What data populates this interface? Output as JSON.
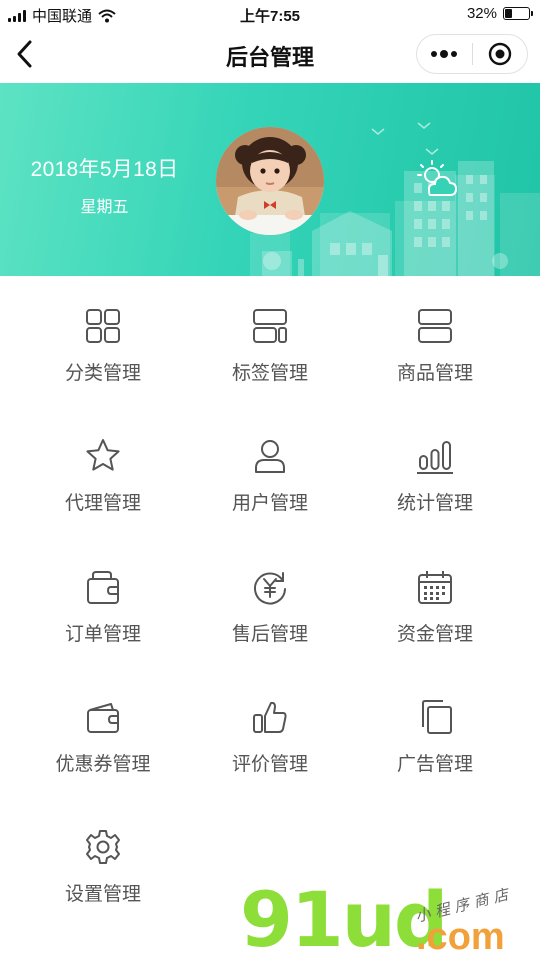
{
  "status_bar": {
    "carrier": "中国联通",
    "time": "上午7:55",
    "battery_percent": "32%",
    "battery_level": 0.32
  },
  "nav": {
    "title": "后台管理",
    "back_icon": "chevron-left-icon",
    "more_icon": "more-dots-icon",
    "close_icon": "target-circle-icon"
  },
  "banner": {
    "date": "2018年5月18日",
    "weekday": "星期五",
    "weather_icon": "partly-cloudy-icon",
    "colors": {
      "start": "#5de3c3",
      "end": "#20c4a6"
    }
  },
  "menu": [
    {
      "label": "分类管理",
      "icon": "category-grid-icon"
    },
    {
      "label": "标签管理",
      "icon": "tag-layout-icon"
    },
    {
      "label": "商品管理",
      "icon": "product-stack-icon"
    },
    {
      "label": "代理管理",
      "icon": "star-icon"
    },
    {
      "label": "用户管理",
      "icon": "user-icon"
    },
    {
      "label": "统计管理",
      "icon": "bar-chart-icon"
    },
    {
      "label": "订单管理",
      "icon": "wallet-icon"
    },
    {
      "label": "售后管理",
      "icon": "yen-refresh-icon"
    },
    {
      "label": "资金管理",
      "icon": "calendar-icon"
    },
    {
      "label": "优惠券管理",
      "icon": "coupon-wallet-icon"
    },
    {
      "label": "评价管理",
      "icon": "thumbs-up-icon"
    },
    {
      "label": "广告管理",
      "icon": "copy-pages-icon"
    },
    {
      "label": "设置管理",
      "icon": "gear-icon"
    }
  ],
  "watermark": {
    "logo": "91ud",
    "subtitle": "小程序商店",
    "domain": ".com"
  },
  "colors": {
    "icon_stroke": "#555555",
    "label_text": "#555555"
  }
}
